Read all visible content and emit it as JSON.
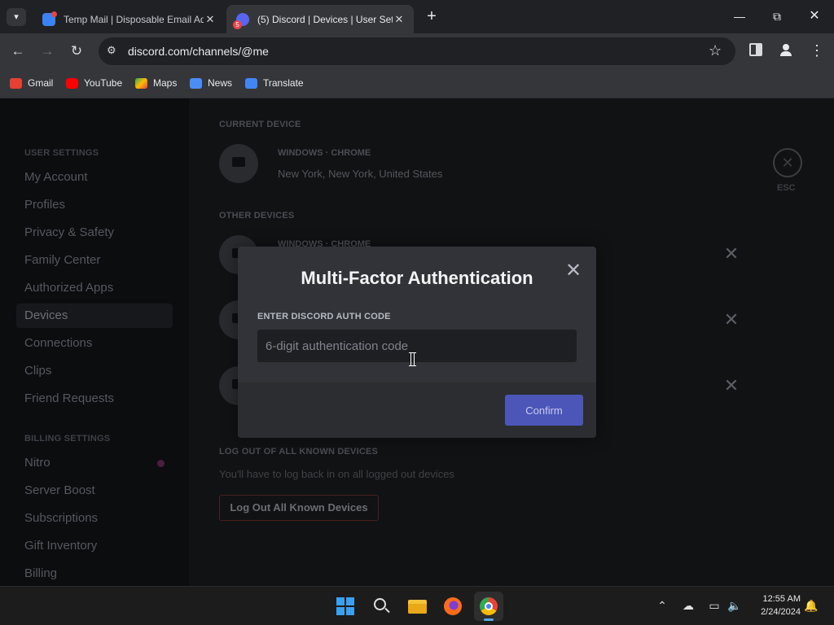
{
  "browser": {
    "tabs": [
      {
        "title": "Temp Mail | Disposable Email Address",
        "active": false
      },
      {
        "title": "(5) Discord | Devices | User Settings",
        "active": true,
        "badge": "5"
      }
    ],
    "new_tab": "+",
    "url": "discord.com/channels/@me",
    "bookmarks": [
      "Gmail",
      "YouTube",
      "Maps",
      "News",
      "Translate"
    ]
  },
  "sidebar": {
    "user_settings_header": "USER SETTINGS",
    "user_items": [
      "My Account",
      "Profiles",
      "Privacy & Safety",
      "Family Center",
      "Authorized Apps",
      "Devices",
      "Connections",
      "Clips",
      "Friend Requests"
    ],
    "billing_header": "BILLING SETTINGS",
    "billing_items": [
      "Nitro",
      "Server Boost",
      "Subscriptions",
      "Gift Inventory",
      "Billing"
    ],
    "active_item": "Devices"
  },
  "content": {
    "current_device_header": "CURRENT DEVICE",
    "current_device": {
      "title": "WINDOWS · CHROME",
      "location": "New York, New York, United States"
    },
    "other_devices_header": "OTHER DEVICES",
    "other_device_title": "WINDOWS · CHROME",
    "esc_label": "ESC",
    "logout_header": "LOG OUT OF ALL KNOWN DEVICES",
    "logout_desc": "You'll have to log back in on all logged out devices",
    "logout_button": "Log Out All Known Devices"
  },
  "modal": {
    "title": "Multi-Factor Authentication",
    "label": "ENTER DISCORD AUTH CODE",
    "input_value": "",
    "input_placeholder": "6-digit authentication code",
    "confirm_button": "Confirm"
  },
  "taskbar": {
    "time": "12:55 AM",
    "date": "2/24/2024"
  },
  "colors": {
    "modal_bg": "#313338",
    "confirm_blue": "#4c56b8",
    "chrome_dark": "#202124"
  }
}
